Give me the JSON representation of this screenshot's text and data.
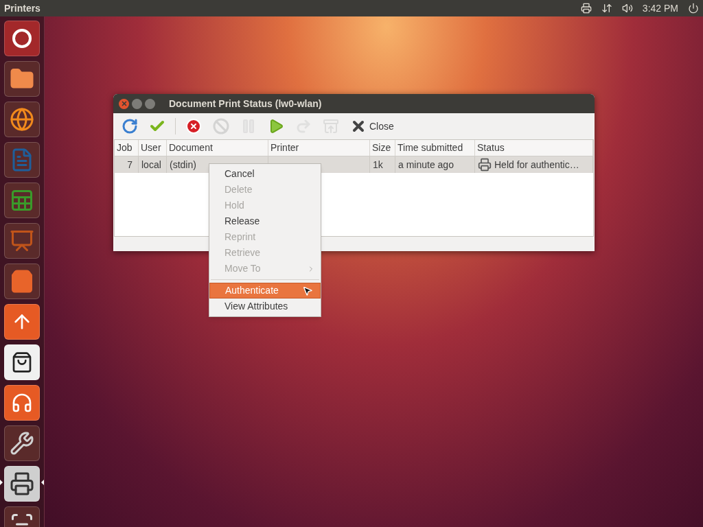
{
  "top_panel": {
    "app_title": "Printers",
    "clock": "3:42 PM"
  },
  "launcher": [
    {
      "kind": "dash",
      "running": false
    },
    {
      "kind": "files",
      "running": false
    },
    {
      "kind": "browser",
      "running": false
    },
    {
      "kind": "writer",
      "running": false
    },
    {
      "kind": "calc",
      "running": false
    },
    {
      "kind": "impress",
      "running": false
    },
    {
      "kind": "software",
      "running": false
    },
    {
      "kind": "cloud",
      "running": false
    },
    {
      "kind": "amazon",
      "running": false
    },
    {
      "kind": "music",
      "running": false
    },
    {
      "kind": "settings",
      "running": false
    },
    {
      "kind": "printer",
      "running": true
    },
    {
      "kind": "scanner",
      "running": false
    }
  ],
  "window": {
    "title": "Document Print Status (lw0-wlan)",
    "toolbar": [
      {
        "kind": "refresh",
        "disabled": false
      },
      {
        "kind": "authenticate",
        "disabled": false
      },
      {
        "kind": "separator"
      },
      {
        "kind": "cancel",
        "disabled": false
      },
      {
        "kind": "delete",
        "disabled": true
      },
      {
        "kind": "hold",
        "disabled": true
      },
      {
        "kind": "release",
        "disabled": false
      },
      {
        "kind": "reprint",
        "disabled": true
      },
      {
        "kind": "retrieve",
        "disabled": true
      },
      {
        "kind": "close",
        "disabled": false,
        "label": "Close"
      }
    ],
    "table": {
      "columns": [
        "Job",
        "User",
        "Document",
        "Printer",
        "Size",
        "Time submitted",
        "Status"
      ],
      "rows": [
        {
          "selected": true,
          "job": "7",
          "user": "local",
          "document": "(stdin)",
          "size": "1k",
          "time_submitted": "a minute ago",
          "status": "Held for authentic…"
        }
      ]
    }
  },
  "context_menu": [
    {
      "kind": "item",
      "label": "Cancel",
      "disabled": false,
      "selected": false,
      "submenu": false
    },
    {
      "kind": "item",
      "label": "Delete",
      "disabled": true,
      "selected": false,
      "submenu": false
    },
    {
      "kind": "item",
      "label": "Hold",
      "disabled": true,
      "selected": false,
      "submenu": false
    },
    {
      "kind": "item",
      "label": "Release",
      "disabled": false,
      "selected": false,
      "submenu": false
    },
    {
      "kind": "item",
      "label": "Reprint",
      "disabled": true,
      "selected": false,
      "submenu": false
    },
    {
      "kind": "item",
      "label": "Retrieve",
      "disabled": true,
      "selected": false,
      "submenu": false
    },
    {
      "kind": "item",
      "label": "Move To",
      "disabled": true,
      "selected": false,
      "submenu": true
    },
    {
      "kind": "separator"
    },
    {
      "kind": "item",
      "label": "Authenticate",
      "disabled": false,
      "selected": true,
      "submenu": false
    },
    {
      "kind": "item",
      "label": "View Attributes",
      "disabled": false,
      "selected": false,
      "submenu": false
    }
  ]
}
